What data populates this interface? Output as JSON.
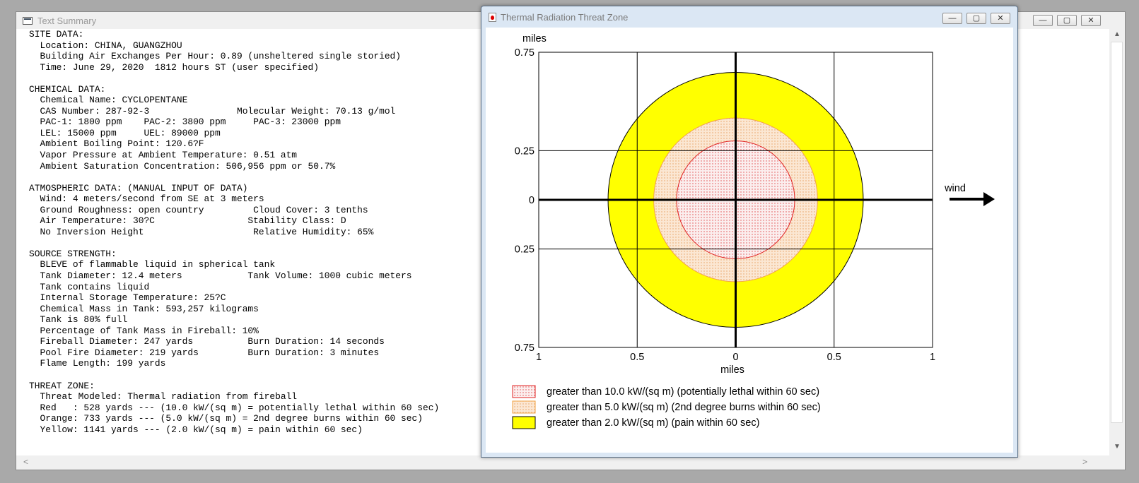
{
  "text_window": {
    "title": "Text Summary",
    "summary_lines": [
      "SITE DATA:",
      "  Location: CHINA, GUANGZHOU",
      "  Building Air Exchanges Per Hour: 0.89 (unsheltered single storied)",
      "  Time: June 29, 2020  1812 hours ST (user specified)",
      "",
      "CHEMICAL DATA:",
      "  Chemical Name: CYCLOPENTANE",
      "  CAS Number: 287-92-3                Molecular Weight: 70.13 g/mol",
      "  PAC-1: 1800 ppm    PAC-2: 3800 ppm     PAC-3: 23000 ppm",
      "  LEL: 15000 ppm     UEL: 89000 ppm",
      "  Ambient Boiling Point: 120.6?F",
      "  Vapor Pressure at Ambient Temperature: 0.51 atm",
      "  Ambient Saturation Concentration: 506,956 ppm or 50.7%",
      "",
      "ATMOSPHERIC DATA: (MANUAL INPUT OF DATA)",
      "  Wind: 4 meters/second from SE at 3 meters",
      "  Ground Roughness: open country         Cloud Cover: 3 tenths",
      "  Air Temperature: 30?C                 Stability Class: D",
      "  No Inversion Height                    Relative Humidity: 65%",
      "",
      "SOURCE STRENGTH:",
      "  BLEVE of flammable liquid in spherical tank",
      "  Tank Diameter: 12.4 meters            Tank Volume: 1000 cubic meters",
      "  Tank contains liquid",
      "  Internal Storage Temperature: 25?C",
      "  Chemical Mass in Tank: 593,257 kilograms",
      "  Tank is 80% full",
      "  Percentage of Tank Mass in Fireball: 10%",
      "  Fireball Diameter: 247 yards          Burn Duration: 14 seconds",
      "  Pool Fire Diameter: 219 yards         Burn Duration: 3 minutes",
      "  Flame Length: 199 yards",
      "",
      "THREAT ZONE:",
      "  Threat Modeled: Thermal radiation from fireball",
      "  Red   : 528 yards --- (10.0 kW/(sq m) = potentially lethal within 60 sec)",
      "  Orange: 733 yards --- (5.0 kW/(sq m) = 2nd degree burns within 60 sec)",
      "  Yellow: 1141 yards --- (2.0 kW/(sq m) = pain within 60 sec)"
    ],
    "buttons": {
      "minimize": "—",
      "maximize": "▢",
      "close": "✕"
    },
    "scroll": {
      "up": "▲",
      "down": "▼",
      "left": "<",
      "right": ">"
    }
  },
  "threat_window": {
    "title": "Thermal Radiation Threat Zone",
    "buttons": {
      "minimize": "—",
      "maximize": "▢",
      "close": "✕"
    },
    "wind_label": "wind",
    "legend": [
      {
        "label": "greater than 10.0 kW/(sq m) (potentially lethal within 60 sec)",
        "fill": "#f7e3e3",
        "stroke": "#e02020",
        "pattern": "dots-red"
      },
      {
        "label": "greater than 5.0 kW/(sq m) (2nd degree burns within 60 sec)",
        "fill": "#f9e1c8",
        "stroke": "#f0a040",
        "pattern": "dots-orange"
      },
      {
        "label": "greater than 2.0 kW/(sq m) (pain within 60 sec)",
        "fill": "#ffff00",
        "stroke": "#000000",
        "pattern": "solid"
      }
    ]
  },
  "chart_data": {
    "type": "area",
    "title": "",
    "xlabel": "miles",
    "ylabel": "miles",
    "xlim": [
      -1,
      1
    ],
    "ylim": [
      -0.75,
      0.75
    ],
    "x_ticks": [
      -1,
      -0.5,
      0,
      0.5,
      1
    ],
    "x_tick_labels": [
      "1",
      "0.5",
      "0",
      "0.5",
      "1"
    ],
    "y_ticks": [
      0.75,
      0.25,
      0,
      -0.25,
      -0.75
    ],
    "y_tick_labels": [
      "0.75",
      "0.25",
      "0",
      "0.25",
      "0.75"
    ],
    "grid": true,
    "series": [
      {
        "name": "greater than 2.0 kW/(sq m) (pain within 60 sec)",
        "radius_yards": 1141,
        "radius_miles": 0.648,
        "color": "#ffff00"
      },
      {
        "name": "greater than 5.0 kW/(sq m) (2nd degree burns within 60 sec)",
        "radius_yards": 733,
        "radius_miles": 0.416,
        "color": "#f9e1c8"
      },
      {
        "name": "greater than 10.0 kW/(sq m) (potentially lethal within 60 sec)",
        "radius_yards": 528,
        "radius_miles": 0.3,
        "color": "#f7e3e3"
      }
    ],
    "legend_position": "bottom-left"
  }
}
